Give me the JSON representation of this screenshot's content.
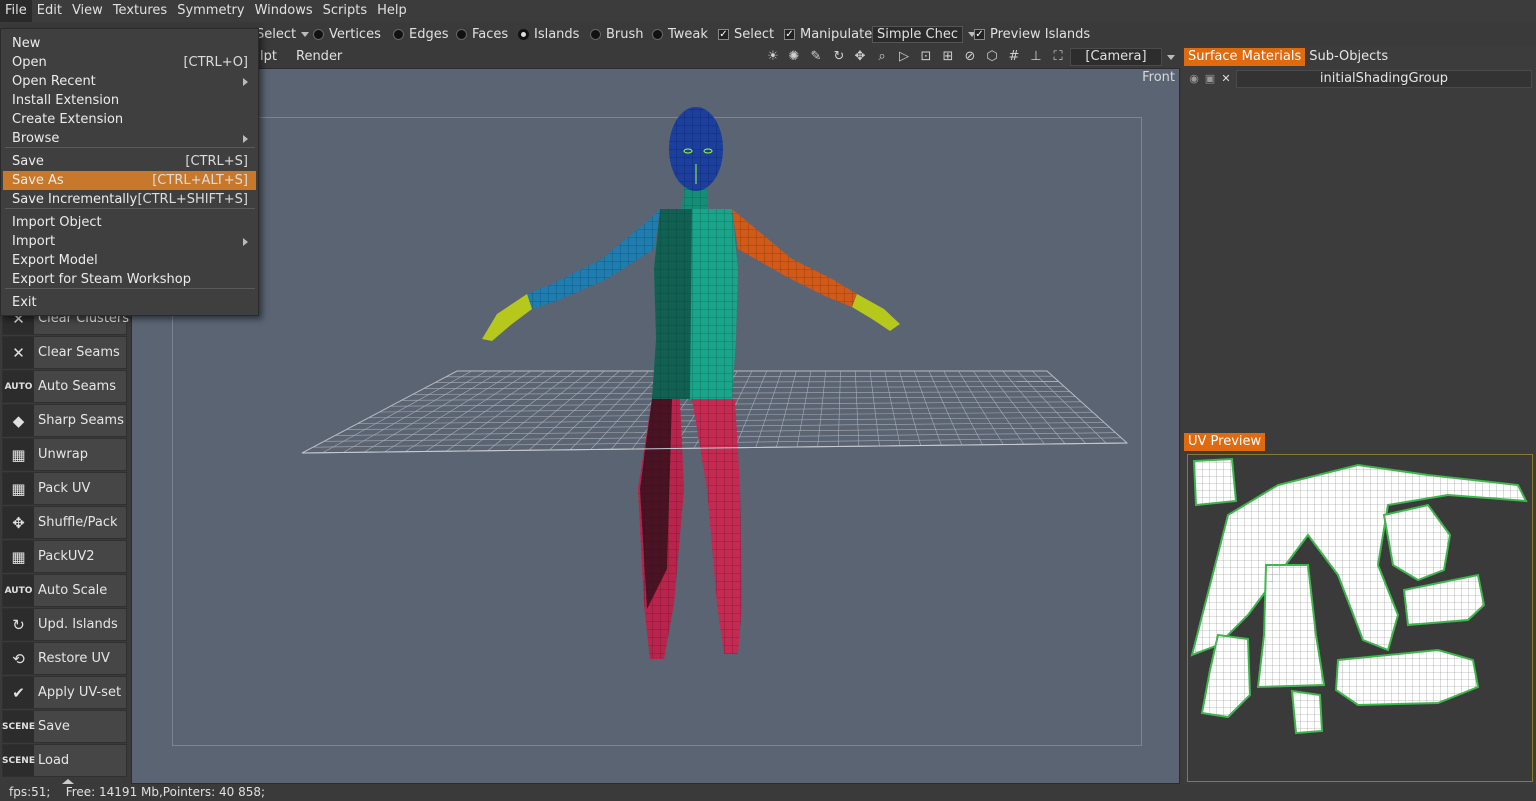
{
  "menubar": [
    "File",
    "Edit",
    "View",
    "Textures",
    "Symmetry",
    "Windows",
    "Scripts",
    "Help"
  ],
  "toolbar2": {
    "select_combo": "Select",
    "modes": [
      "Vertices",
      "Edges",
      "Faces",
      "Islands",
      "Brush",
      "Tweak"
    ],
    "active_mode": "Islands",
    "select_check": "Select",
    "manipulate_check": "Manipulate",
    "checker_combo": "Simple Chec",
    "preview_islands": "Preview Islands"
  },
  "toolbar3": {
    "tabs": [
      "lpt",
      "Render"
    ],
    "camera": "[Camera]"
  },
  "viewport": {
    "view_label": "Front"
  },
  "tools": [
    {
      "label": "Clear Clusters",
      "icon": "✕"
    },
    {
      "label": "Clear Seams",
      "icon": "✕"
    },
    {
      "label": "Auto Seams",
      "icon": "AUTO"
    },
    {
      "label": "Sharp Seams",
      "icon": "◆"
    },
    {
      "label": "Unwrap",
      "icon": "▦"
    },
    {
      "label": "Pack UV",
      "icon": "▦"
    },
    {
      "label": "Shuffle/Pack",
      "icon": "✥"
    },
    {
      "label": "PackUV2",
      "icon": "▦"
    },
    {
      "label": "Auto Scale",
      "icon": "AUTO"
    },
    {
      "label": "Upd. Islands",
      "icon": "↻"
    },
    {
      "label": "Restore UV",
      "icon": "⟲"
    },
    {
      "label": "Apply UV-set",
      "icon": "✔"
    },
    {
      "label": "Save",
      "icon": "SCENE"
    },
    {
      "label": "Load",
      "icon": "SCENE"
    }
  ],
  "right_panel": {
    "tabs": [
      "Surface Materials",
      "Sub-Objects"
    ],
    "material": "initialShadingGroup",
    "uv_title": "UV Preview"
  },
  "status": "fps:51;    Free: 14191 Mb,Pointers: 40 858;",
  "file_menu": [
    {
      "label": "New",
      "shortcut": ""
    },
    {
      "label": "Open",
      "shortcut": "[CTRL+O]"
    },
    {
      "label": "Open Recent",
      "shortcut": ""
    },
    {
      "label": "Install Extension",
      "shortcut": ""
    },
    {
      "label": "Create Extension",
      "shortcut": ""
    },
    {
      "label": "Browse",
      "shortcut": ""
    },
    {
      "label": "Save",
      "shortcut": "[CTRL+S]"
    },
    {
      "label": "Save As",
      "shortcut": "[CTRL+ALT+S]"
    },
    {
      "label": "Save Incrementally",
      "shortcut": "[CTRL+SHIFT+S]"
    },
    {
      "label": "Import Object",
      "shortcut": ""
    },
    {
      "label": "Import",
      "shortcut": ""
    },
    {
      "label": "Export Model",
      "shortcut": ""
    },
    {
      "label": "Export for Steam Workshop",
      "shortcut": ""
    },
    {
      "label": "Exit",
      "shortcut": ""
    }
  ],
  "colors": {
    "accent": "#e06a10",
    "highlight": "#c8782a",
    "viewport_bg": "#5a6473"
  }
}
